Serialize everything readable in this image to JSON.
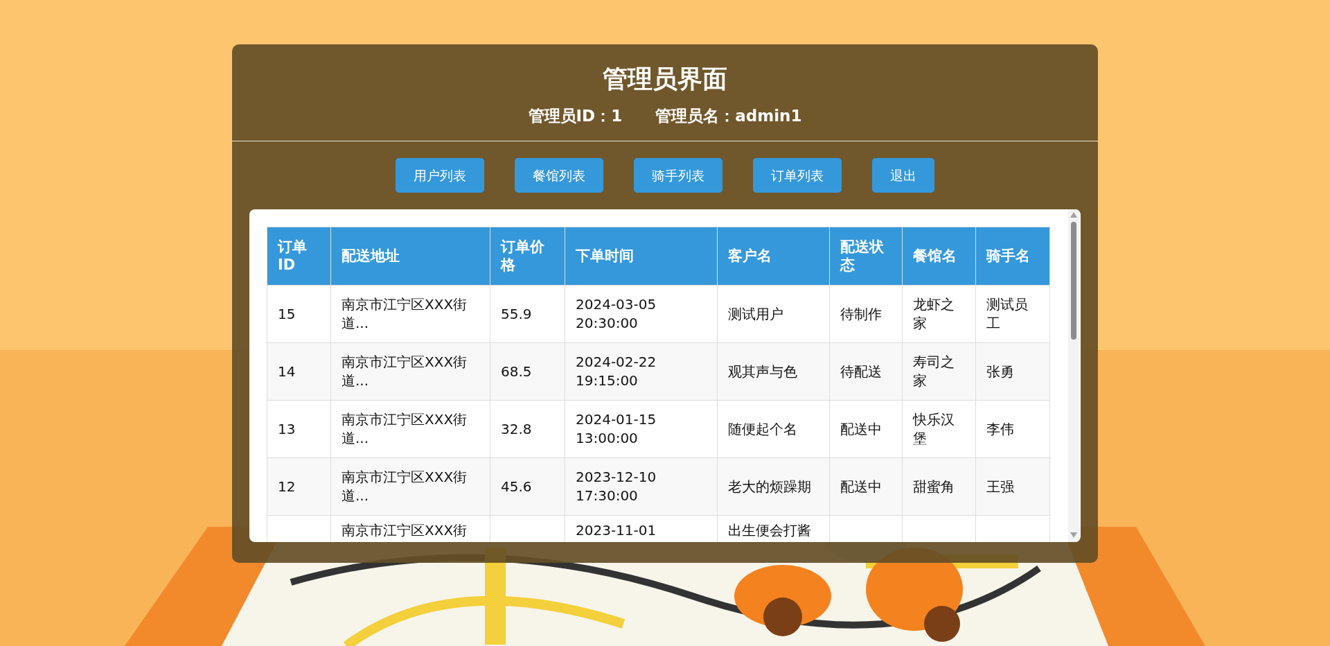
{
  "header": {
    "title": "管理员界面",
    "admin_id": "管理员ID：1",
    "admin_name": "管理员名：admin1"
  },
  "nav_buttons": [
    "用户列表",
    "餐馆列表",
    "骑手列表",
    "订单列表",
    "退出"
  ],
  "table": {
    "columns": [
      "订单ID",
      "配送地址",
      "订单价格",
      "下单时间",
      "客户名",
      "配送状态",
      "餐馆名",
      "骑手名"
    ],
    "rows": [
      [
        "15",
        "南京市江宁区XXX街道...",
        "55.9",
        "2024-03-05 20:30:00",
        "测试用户",
        "待制作",
        "龙虾之家",
        "测试员工"
      ],
      [
        "14",
        "南京市江宁区XXX街道...",
        "68.5",
        "2024-02-22 19:15:00",
        "观其声与色",
        "待配送",
        "寿司之家",
        "张勇"
      ],
      [
        "13",
        "南京市江宁区XXX街道...",
        "32.8",
        "2024-01-15 13:00:00",
        "随便起个名",
        "配送中",
        "快乐汉堡",
        "李伟"
      ],
      [
        "12",
        "南京市江宁区XXX街道...",
        "45.6",
        "2023-12-10 17:30:00",
        "老大的烦躁期",
        "配送中",
        "甜蜜角",
        "王强"
      ]
    ],
    "cut_row": {
      "address": "南京市江宁区XXX街",
      "time": "2023-11-01",
      "customer": "出生便会打酱"
    }
  }
}
